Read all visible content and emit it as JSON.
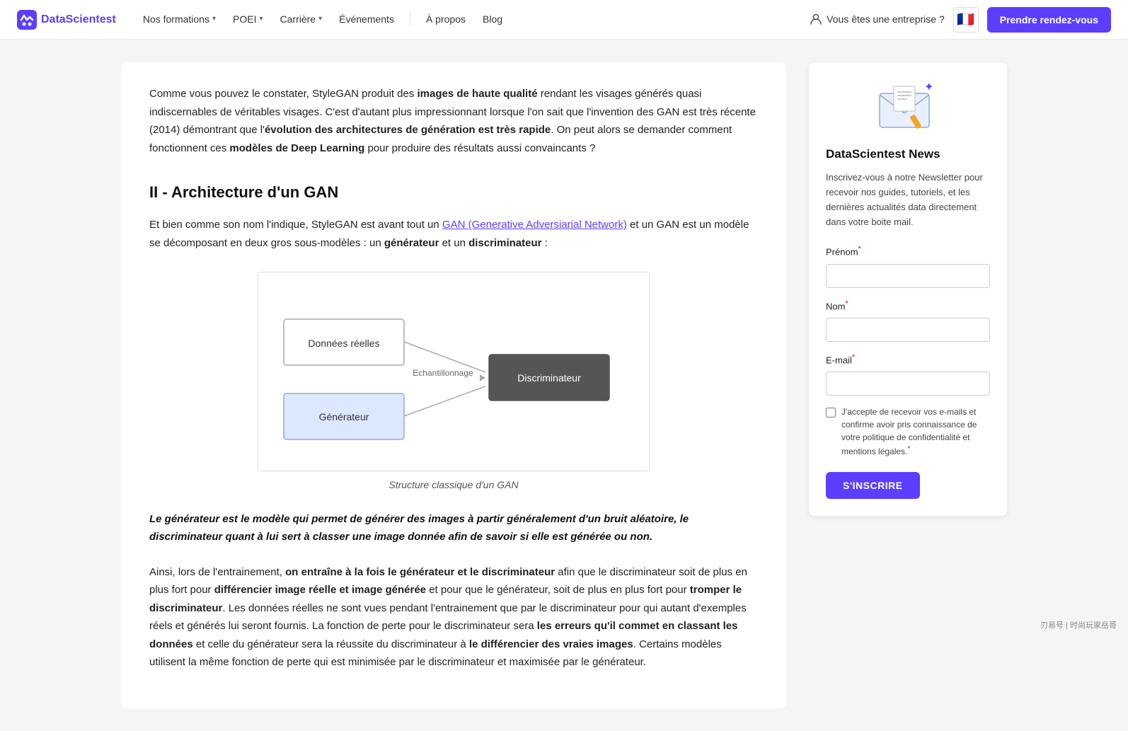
{
  "nav": {
    "logo_text": "DataScientest",
    "links": [
      {
        "label": "Nos formations",
        "has_chevron": true
      },
      {
        "label": "POEI",
        "has_chevron": true
      },
      {
        "label": "Carrière",
        "has_chevron": true
      },
      {
        "label": "Événements",
        "has_chevron": false
      },
      {
        "label": "À propos",
        "has_chevron": false
      },
      {
        "label": "Blog",
        "has_chevron": false
      }
    ],
    "enterprise_label": "Vous êtes une entreprise ?",
    "cta_label": "Prendre rendez-vous"
  },
  "article": {
    "para1": "Comme vous pouvez le constater, StyleGAN produit des ",
    "para1_bold1": "images de haute qualité",
    "para1_rest": " rendant les visages générés quasi indiscernables de véritables visages. C'est d'autant plus impressionnant lorsque l'on sait que l'invention des GAN est très récente (2014) démontrant que l'",
    "para1_bold2": "évolution des architectures de génération est très rapide",
    "para1_end": ". On peut alors se demander comment fonctionnent ces ",
    "para1_bold3": "modèles de Deep Learning",
    "para1_tail": " pour produire des résultats aussi convaincants ?",
    "section_heading": "II - Architecture d'un GAN",
    "para2_start": "Et bien comme son nom l'indique, StyleGAN est avant tout un ",
    "para2_link": "GAN (Generative Adversiarial Network)",
    "para2_end": " et un GAN est un modèle se décomposant en deux gros sous-modèles : un ",
    "para2_bold1": "générateur",
    "para2_mid": " et un ",
    "para2_bold2": "discriminateur",
    "para2_tail": " :",
    "diagram_caption": "Structure classique d'un GAN",
    "quote": "Le générateur est le modèle qui permet de générer des images à partir généralement d'un bruit aléatoire, le discriminateur quant à lui sert à classer une image donnée afin de savoir si elle est générée ou non.",
    "para3_start": "Ainsi, lors de l'entrainement, ",
    "para3_bold1": "on entraîne à la fois le générateur et le discriminateur",
    "para3_mid1": " afin que le discriminateur soit de plus en plus fort pour ",
    "para3_bold2": "différencier image réelle et image générée",
    "para3_mid2": " et pour que le générateur, soit de plus en plus fort pour ",
    "para3_bold3": "tromper le discriminateur",
    "para3_mid3": ". Les données réelles ne sont vues pendant l'entrainement que par le discriminateur pour qui autant d'exemples réels et générés lui seront fournis. La fonction de perte pour le discriminateur sera ",
    "para3_bold4": "les erreurs qu'il commet en classant les données",
    "para3_mid4": " et celle du générateur sera la réussite du discriminateur à ",
    "para3_bold5": "le différencier des vraies images",
    "para3_tail": ". Certains modèles utilisent la même fonction de perte qui est minimisée par le discriminateur et maximisée par le générateur.",
    "diagram": {
      "donnees_label": "Données réelles",
      "echantillonnage_label": "Echantillonnage",
      "discriminateur_label": "Discriminateur",
      "generateur_label": "Générateur"
    }
  },
  "sidebar": {
    "widget_title": "DataScientest News",
    "widget_desc": "Inscrivez-vous à notre Newsletter pour recevoir nos guides, tutoriels, et les dernières actualités data directement dans votre boite mail.",
    "form": {
      "prenom_label": "Prénom",
      "prenom_required": "*",
      "nom_label": "Nom",
      "nom_required": "*",
      "email_label": "E-mail",
      "email_required": "*",
      "checkbox_text": "J'accepte de recevoir vos e-mails et confirme avoir pris connaissance de votre politique de confidentialité et mentions légales.",
      "checkbox_required": "*",
      "submit_label": "S'INSCRIRE"
    }
  },
  "watermark": "刃易号 | 时尚玩家岳哥"
}
